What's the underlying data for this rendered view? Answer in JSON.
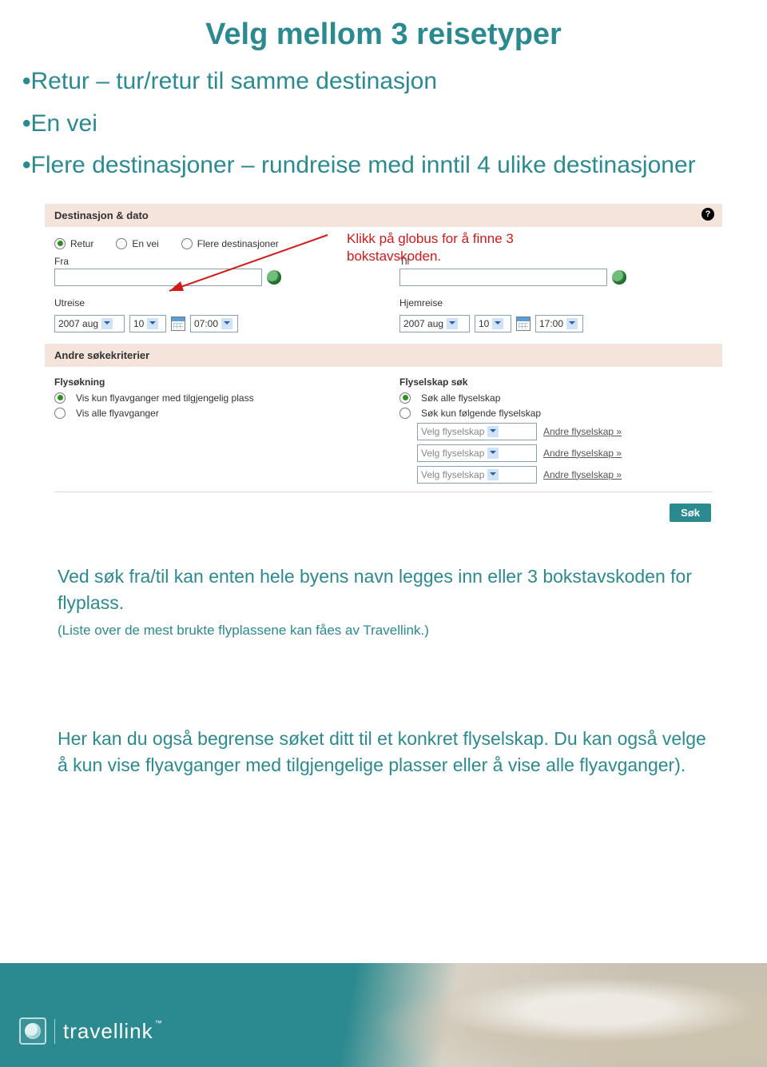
{
  "title": "Velg mellom 3 reisetyper",
  "bullets": [
    "Retur – tur/retur til samme destinasjon",
    "En vei",
    "Flere destinasjoner – rundreise med inntil 4 ulike destinasjoner"
  ],
  "callout": "Klikk på globus for å finne 3 bokstavskoden.",
  "form": {
    "section1": "Destinasjon & dato",
    "trip_types": {
      "retur": "Retur",
      "envei": "En vei",
      "flere": "Flere destinasjoner"
    },
    "fra_label": "Fra",
    "til_label": "Til",
    "utreise_label": "Utreise",
    "hjemreise_label": "Hjemreise",
    "month": "2007 aug",
    "day": "10",
    "time_out": "07:00",
    "time_home": "17:00",
    "section2": "Andre søkekriterier",
    "flysokning_head": "Flysøkning",
    "flysokning_opt1": "Vis kun flyavganger med tilgjengelig plass",
    "flysokning_opt2": "Vis alle flyavganger",
    "flyselskap_head": "Flyselskap søk",
    "flyselskap_opt1": "Søk alle flyselskap",
    "flyselskap_opt2": "Søk kun følgende flyselskap",
    "velg_placeholder": "Velg flyselskap",
    "andre_link": "Andre flyselskap »",
    "sok": "Søk"
  },
  "para1": "Ved søk fra/til kan enten hele byens navn legges inn eller 3 bokstavskoden for flyplass.",
  "para1_small": "(Liste over de mest brukte flyplassene kan fåes av Travellink.)",
  "para2": "Her kan du også begrense søket ditt til et konkret flyselskap. Du kan også velge å kun vise flyavganger med tilgjengelige plasser eller å vise alle flyavganger).",
  "footer": {
    "brand": "travellink",
    "tm": "™"
  }
}
